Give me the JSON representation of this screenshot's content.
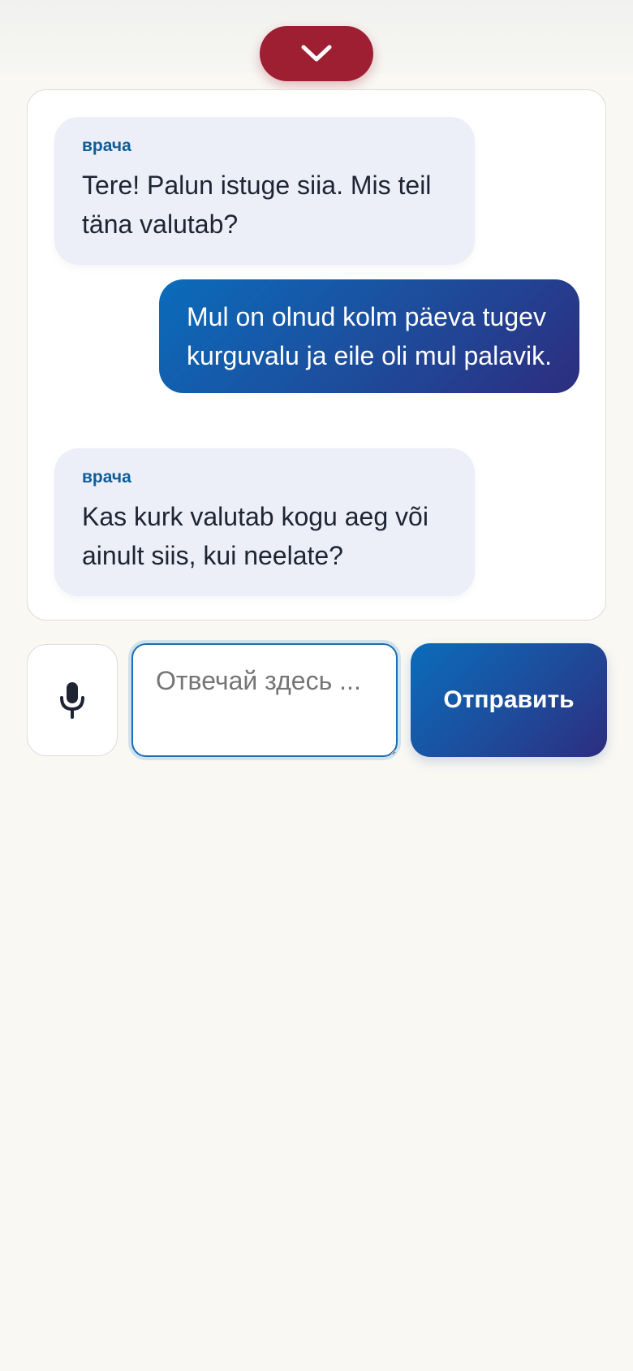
{
  "header": {
    "collapse_icon": "chevron-down-icon",
    "accent_color": "#9d1f31"
  },
  "chat": {
    "messages": [
      {
        "role": "doctor",
        "speaker": "врача",
        "text": "Tere! Palun istuge siia. Mis teil täna valutab?"
      },
      {
        "role": "patient",
        "speaker": "",
        "text": "Mul on olnud kolm päeva tugev kurguvalu ja eile oli mul palavik."
      },
      {
        "role": "doctor",
        "speaker": "врача",
        "text": "Kas kurk valutab kogu aeg või ainult siis, kui neelate?"
      }
    ]
  },
  "composer": {
    "mic_icon": "microphone-icon",
    "placeholder": "Отвечай здесь ...",
    "value": "",
    "send_label": "Отправить"
  },
  "colors": {
    "primary_gradient_start": "#0a6cbb",
    "primary_gradient_end": "#2d2d7f",
    "speaker_label": "#0c5d98",
    "doctor_bubble": "#eceef8"
  }
}
